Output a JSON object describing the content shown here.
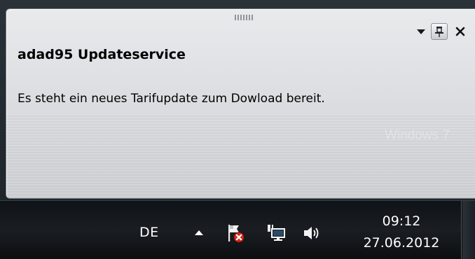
{
  "notification": {
    "title": "adad95 Updateservice",
    "message": "Es steht ein neues Tarifupdate zum Dowload bereit.",
    "icons": {
      "grip": "grip-icon",
      "menu": "dropdown-arrow-icon",
      "pin": "pin-icon",
      "close": "close-icon"
    }
  },
  "watermark": {
    "line1": "Windows 7",
    "line2": ""
  },
  "taskbar": {
    "language": "DE",
    "time": "09:12",
    "date": "27.06.2012",
    "tray_icons": [
      "show-hidden-icons-arrow-icon",
      "action-center-flag-error-icon",
      "network-icon",
      "volume-icon"
    ]
  },
  "colors": {
    "popup_background": "#dcdee1",
    "taskbar_background": "#14181c",
    "error_badge": "#d9261c",
    "taskbar_text": "#ffffff"
  }
}
